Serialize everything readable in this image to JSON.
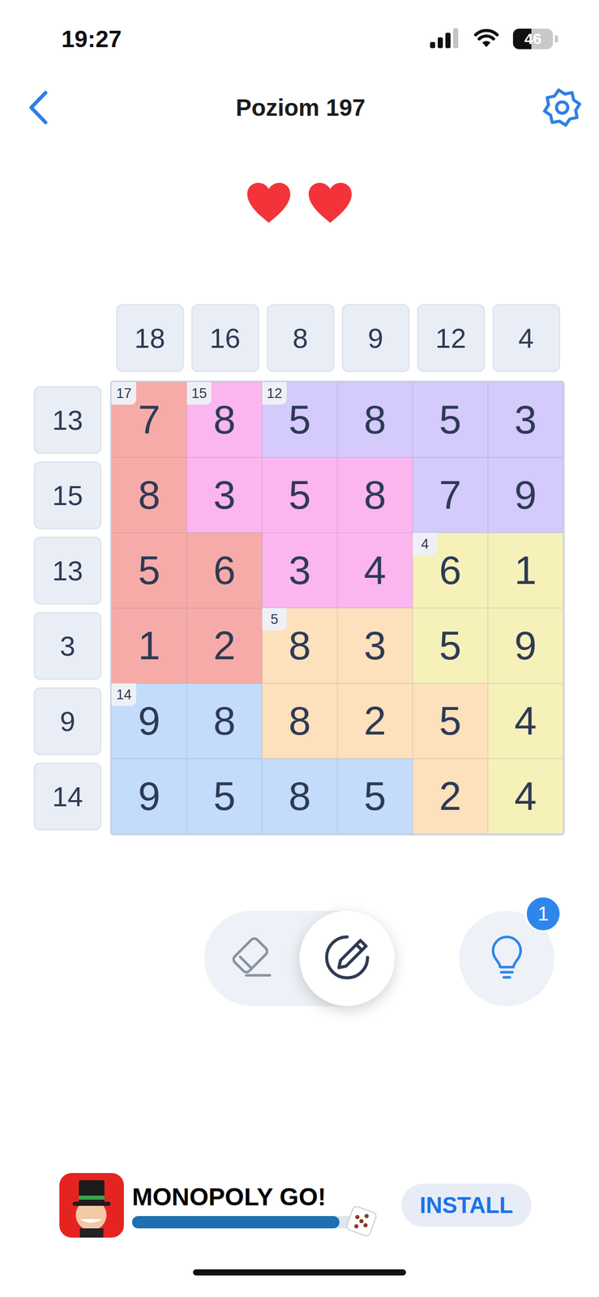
{
  "status_bar": {
    "time": "19:27",
    "signal_level": 0.75,
    "battery": {
      "text": "46",
      "level": 0.46
    }
  },
  "header": {
    "title": "Poziom 197"
  },
  "lives": [
    {
      "filled": true
    },
    {
      "filled": true
    }
  ],
  "column_clues": [
    "18",
    "16",
    "8",
    "9",
    "12",
    "4"
  ],
  "row_clues": [
    "13",
    "15",
    "13",
    "3",
    "9",
    "14"
  ],
  "board": {
    "rows": [
      {
        "cells": [
          {
            "value": "7",
            "color": "#f7aba8",
            "cage_sum": "17"
          },
          {
            "value": "8",
            "color": "#fbb5ef",
            "cage_sum": "15"
          },
          {
            "value": "5",
            "color": "#d4cafb",
            "cage_sum": "12"
          },
          {
            "value": "8",
            "color": "#d4cafb"
          },
          {
            "value": "5",
            "color": "#d4cafb"
          },
          {
            "value": "3",
            "color": "#d4cafb"
          }
        ]
      },
      {
        "cells": [
          {
            "value": "8",
            "color": "#f7aba8"
          },
          {
            "value": "3",
            "color": "#fbb5ef"
          },
          {
            "value": "5",
            "color": "#fbb5ef"
          },
          {
            "value": "8",
            "color": "#fbb5ef"
          },
          {
            "value": "7",
            "color": "#d4cafb"
          },
          {
            "value": "9",
            "color": "#d4cafb"
          }
        ]
      },
      {
        "cells": [
          {
            "value": "5",
            "color": "#f7aba8"
          },
          {
            "value": "6",
            "color": "#f7aba8"
          },
          {
            "value": "3",
            "color": "#fbb5ef"
          },
          {
            "value": "4",
            "color": "#fbb5ef"
          },
          {
            "value": "6",
            "color": "#f6f0b9",
            "cage_sum": "4"
          },
          {
            "value": "1",
            "color": "#f6f0b9"
          }
        ]
      },
      {
        "cells": [
          {
            "value": "1",
            "color": "#f7aba8"
          },
          {
            "value": "2",
            "color": "#f7aba8"
          },
          {
            "value": "8",
            "color": "#fde0bc",
            "cage_sum": "5"
          },
          {
            "value": "3",
            "color": "#fde0bc"
          },
          {
            "value": "5",
            "color": "#f6f0b9"
          },
          {
            "value": "9",
            "color": "#f6f0b9"
          }
        ]
      },
      {
        "cells": [
          {
            "value": "9",
            "color": "#c3dcfb",
            "cage_sum": "14"
          },
          {
            "value": "8",
            "color": "#c3dcfb"
          },
          {
            "value": "8",
            "color": "#fde0bc"
          },
          {
            "value": "2",
            "color": "#fde0bc"
          },
          {
            "value": "5",
            "color": "#fde0bc"
          },
          {
            "value": "4",
            "color": "#f6f0b9"
          }
        ]
      },
      {
        "cells": [
          {
            "value": "9",
            "color": "#c3dcfb"
          },
          {
            "value": "5",
            "color": "#c3dcfb"
          },
          {
            "value": "8",
            "color": "#c3dcfb"
          },
          {
            "value": "5",
            "color": "#c3dcfb"
          },
          {
            "value": "2",
            "color": "#fde0bc"
          },
          {
            "value": "4",
            "color": "#f6f0b9"
          }
        ]
      }
    ]
  },
  "tools": [
    {
      "kind": "eraser",
      "selected": false
    },
    {
      "kind": "pencil",
      "selected": true
    }
  ],
  "hint": {
    "badge": "1"
  },
  "ad": {
    "title": "MONOPOLY GO!",
    "level": 0.9,
    "button": "INSTALL"
  }
}
